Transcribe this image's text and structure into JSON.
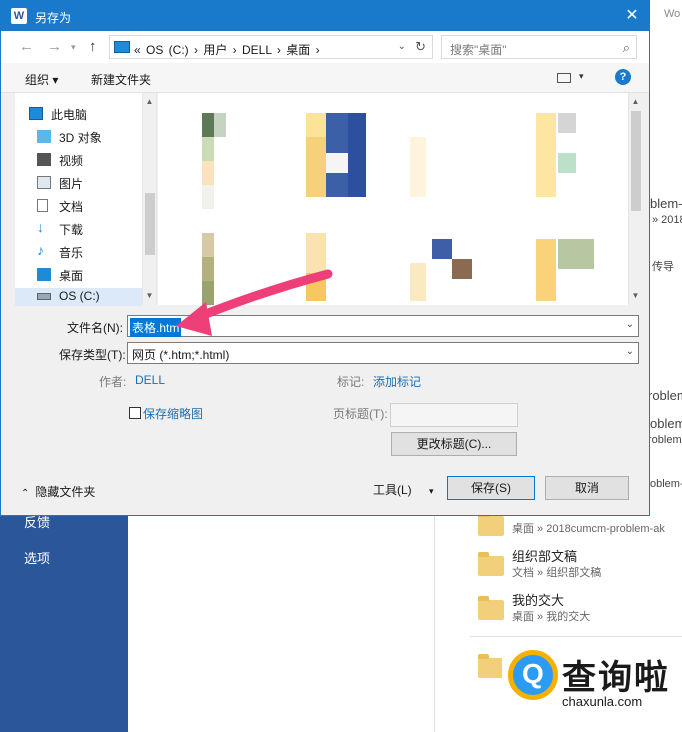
{
  "dialog": {
    "title": "另存为",
    "close": "✕",
    "address": {
      "path": "« OS (C:) › 用户 › DELL › 桌面 ›",
      "search_placeholder": "搜索\"桌面\""
    },
    "toolbar": {
      "organize": "组织 ▾",
      "new_folder": "新建文件夹",
      "help": "?"
    },
    "sidebar": {
      "items": [
        {
          "label": "此电脑",
          "icon": "computer-icon"
        },
        {
          "label": "3D 对象",
          "icon": "cube-icon"
        },
        {
          "label": "视频",
          "icon": "video-icon"
        },
        {
          "label": "图片",
          "icon": "picture-icon"
        },
        {
          "label": "文档",
          "icon": "document-icon"
        },
        {
          "label": "下载",
          "icon": "download-icon"
        },
        {
          "label": "音乐",
          "icon": "music-icon"
        },
        {
          "label": "桌面",
          "icon": "desktop-icon"
        },
        {
          "label": "OS (C:)",
          "icon": "drive-icon"
        }
      ]
    },
    "form": {
      "filename_label": "文件名(N):",
      "filename_value": "表格.htm",
      "savetype_label": "保存类型(T):",
      "savetype_value": "网页 (*.htm;*.html)",
      "author_label": "作者:",
      "author_value": "DELL",
      "tags_label": "标记:",
      "tags_value": "添加标记",
      "thumbnail_label": "保存缩略图",
      "page_title_label": "页标题(T):",
      "change_title_button": "更改标题(C)..."
    },
    "footer": {
      "hide_folders": "隐藏文件夹",
      "tools": "工具(L)",
      "save": "保存(S)",
      "cancel": "取消"
    }
  },
  "background": {
    "top_right": "Wo",
    "left_nav": [
      "反馈",
      "选项"
    ],
    "cut_texts": [
      "blem-A",
      "» 2018",
      "传导",
      "roblem-A",
      "oblem-A",
      "roblem-A",
      "oblem-A"
    ],
    "recent": [
      {
        "title": "",
        "path": "桌面 » 2018cumcm-problem-ak"
      },
      {
        "title": "组织部文稿",
        "path": "文档 » 组织部文稿"
      },
      {
        "title": "我的交大",
        "path": "桌面 » 我的交大"
      }
    ]
  },
  "watermark": {
    "cn": "查询啦",
    "en": "chaxunla.com"
  }
}
